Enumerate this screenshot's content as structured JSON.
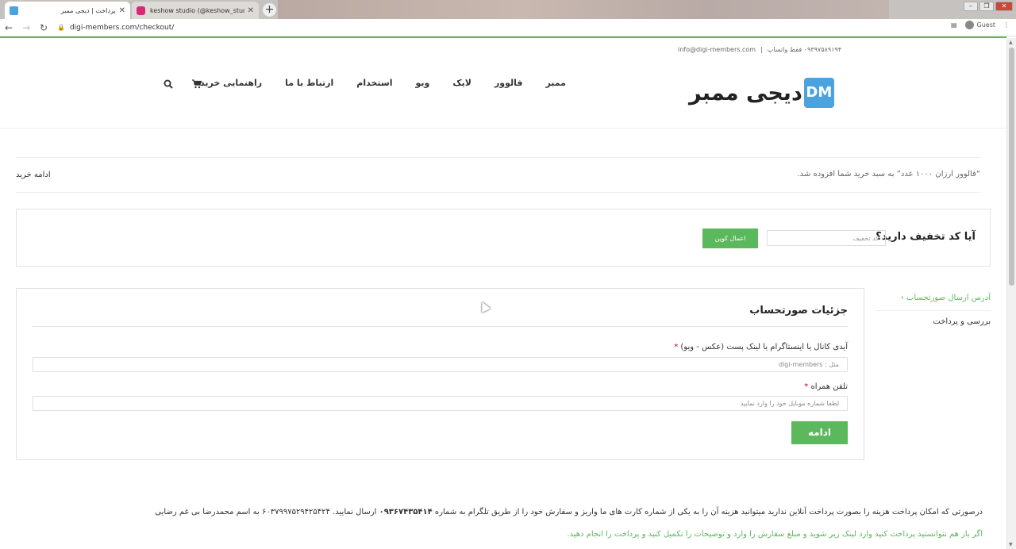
{
  "browser": {
    "tabs": [
      {
        "title": "پرداخت | دیجی ممبر",
        "active": true
      },
      {
        "title": "keshow studio (@keshow_studio)",
        "active": false
      }
    ],
    "new_tab": "+",
    "url": "digi-members.com/checkout/",
    "profile": "Guest",
    "colors": {
      "accent": "#5cb85c",
      "logo_blue": "#4aa3df"
    }
  },
  "header": {
    "topbar_phone": "۰۹۳۹۷۵۸۹۱۹۴ فقط واتساپ",
    "topbar_sep": "|",
    "topbar_email": "info@digi-members.com",
    "logo_mark": "DM",
    "logo_text": "دیجی ممبر",
    "nav": [
      "ممبر",
      "فالوور",
      "لایک",
      "ویو",
      "استخدام",
      "ارتباط با ما",
      "راهنمایی خرید"
    ],
    "icons": [
      "search-icon",
      "cart-icon"
    ]
  },
  "notice": {
    "message": "“فالوور ارزان ۱۰۰۰ عدد” به سبد خرید شما افزوده شد.",
    "continue": "ادامه خرید"
  },
  "coupon": {
    "question": "آیا کد تخفیف دارید؟",
    "placeholder": "کد تخفیف",
    "button": "اعمال کوپن"
  },
  "steps": {
    "address": "آدرس ارسال صورتحساب ›",
    "review": "بررسی و پرداخت"
  },
  "form": {
    "title": "جزئیات صورتحساب",
    "field1_label": "آیدی کانال یا اینستاگرام یا لینک پست (عکس - ویو)",
    "field1_placeholder": "مثل : digi-members",
    "field2_label": "تلفن همراه",
    "field2_placeholder": "لطفا شماره موبایل خود را وارد نمایید",
    "required": "*",
    "submit": "ادامه"
  },
  "info": {
    "line1_a": "درصورتی که امکان پرداخت هزینه را بصورت پرداخت آنلاین ندارید میتوانید هزینه آن را به یکی از شماره کارت های ما واریز و سفارش خود را از طریق تلگرام به شماره",
    "line1_phone": "۰۹۳۶۷۴۳۵۴۱۴",
    "line1_b": "ارسال نمایید.  ۶۰۳۷۹۹۷۵۲۹۴۲۵۴۲۴ به اسم محمدرضا بی غم رضایی",
    "line2": "اگر باز هم نتوانستید پرداخت کنید وارد لینک زیر شوید و مبلغ سفارش را وارد و توضیحات را تکمیل کنید و پرداخت را انجام دهید."
  }
}
